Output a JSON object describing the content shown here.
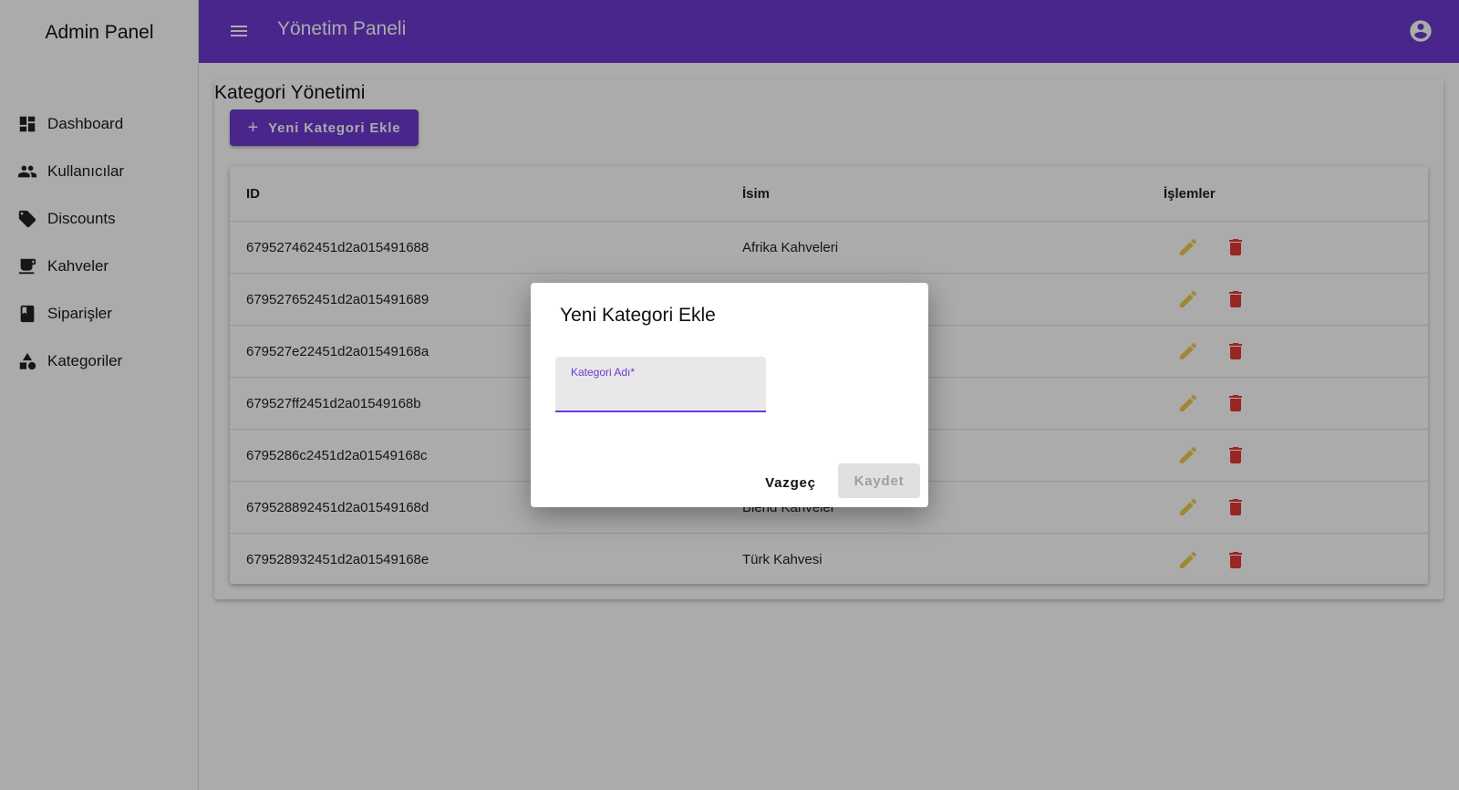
{
  "sidebar": {
    "title": "Admin Panel",
    "items": [
      {
        "label": "Dashboard",
        "icon": "dashboard-icon"
      },
      {
        "label": "Kullanıcılar",
        "icon": "people-icon"
      },
      {
        "label": "Discounts",
        "icon": "tag-icon"
      },
      {
        "label": "Kahveler",
        "icon": "coffee-icon"
      },
      {
        "label": "Siparişler",
        "icon": "book-icon"
      },
      {
        "label": "Kategoriler",
        "icon": "category-icon"
      }
    ]
  },
  "topbar": {
    "title": "Yönetim Paneli",
    "menu_icon": "menu-icon",
    "account_icon": "account-circle-icon",
    "color": "#6c3ad1"
  },
  "main": {
    "title": "Kategori Yönetimi",
    "add_button_label": "Yeni Kategori Ekle",
    "table": {
      "headers": {
        "id": "ID",
        "name": "İsim",
        "actions": "İşlemler"
      },
      "rows": [
        {
          "id": "679527462451d2a015491688",
          "name": "Afrika Kahveleri"
        },
        {
          "id": "679527652451d2a015491689",
          "name": ""
        },
        {
          "id": "679527e22451d2a01549168a",
          "name": ""
        },
        {
          "id": "679527ff2451d2a01549168b",
          "name": ""
        },
        {
          "id": "6795286c2451d2a01549168c",
          "name": ""
        },
        {
          "id": "679528892451d2a01549168d",
          "name": "Blend Kahveler"
        },
        {
          "id": "679528932451d2a01549168e",
          "name": "Türk Kahvesi"
        }
      ]
    }
  },
  "dialog": {
    "title": "Yeni Kategori Ekle",
    "field_label": "Kategori Adı*",
    "field_value": "",
    "cancel_label": "Vazgeç",
    "save_label": "Kaydet"
  }
}
